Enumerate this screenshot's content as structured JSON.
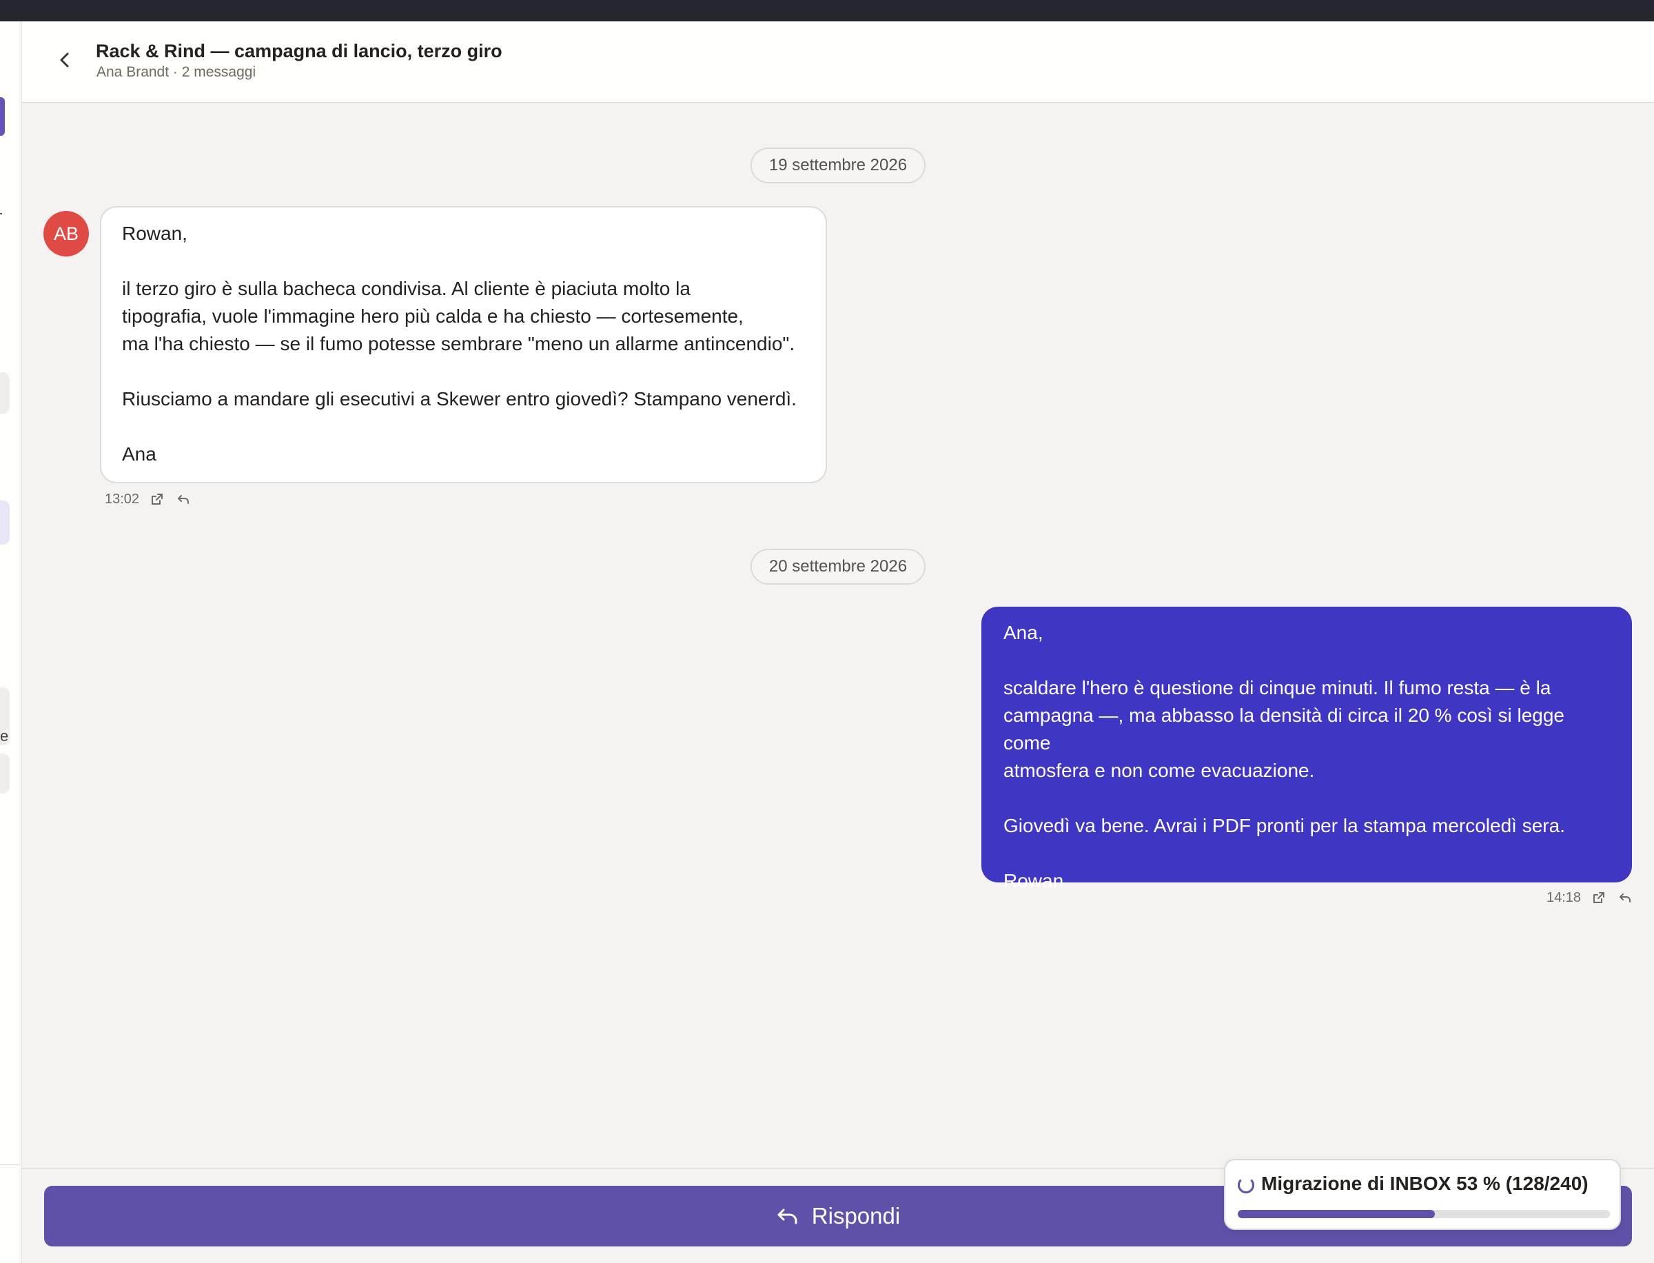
{
  "header": {
    "back_icon": "chevron-left-icon",
    "title": "Rack & Rind — campagna di lancio, terzo giro",
    "subtitle": "Ana Brandt · 2 messaggi"
  },
  "sidebar": {
    "partial_letter": "e"
  },
  "conversation": {
    "messages": [
      {
        "date": "19 settembre 2026",
        "sender_initials": "AB",
        "avatar_color": "#df4b44",
        "greeting": "Rowan,",
        "line1": "il terzo giro è sulla bacheca condivisa. Al cliente è piaciuta molto la",
        "line2": "tipografia, vuole l'immagine hero più calda e ha chiesto — cortesemente,",
        "line3": "ma l'ha chiesto — se il fumo potesse sembrare \"meno un allarme antincendio\".",
        "para2": "Riusciamo a mandare gli esecutivi a Skewer entro giovedì? Stampano venerdì.",
        "signoff": "Ana",
        "time": "13:02"
      },
      {
        "date": "20 settembre 2026",
        "greeting": "Ana,",
        "line1": "scaldare l'hero è questione di cinque minuti. Il fumo resta — è la",
        "line2": "campagna —, ma abbasso la densità di circa il 20 % così si legge come",
        "line3": "atmosfera e non come evacuazione.",
        "para2": "Giovedì va bene. Avrai i PDF pronti per la stampa mercoledì sera.",
        "signoff": "Rowan",
        "time": "14:18",
        "bubble_color": "#3f36c4"
      }
    ]
  },
  "reply": {
    "label": "Rispondi",
    "icon": "reply-icon"
  },
  "migration_toast": {
    "text": "Migrazione di INBOX 53 % (128/240)",
    "progress": 0.53
  },
  "colors": {
    "accent": "#5f51a8",
    "outgoing_bubble": "#3f36c4",
    "avatar": "#df4b44"
  }
}
